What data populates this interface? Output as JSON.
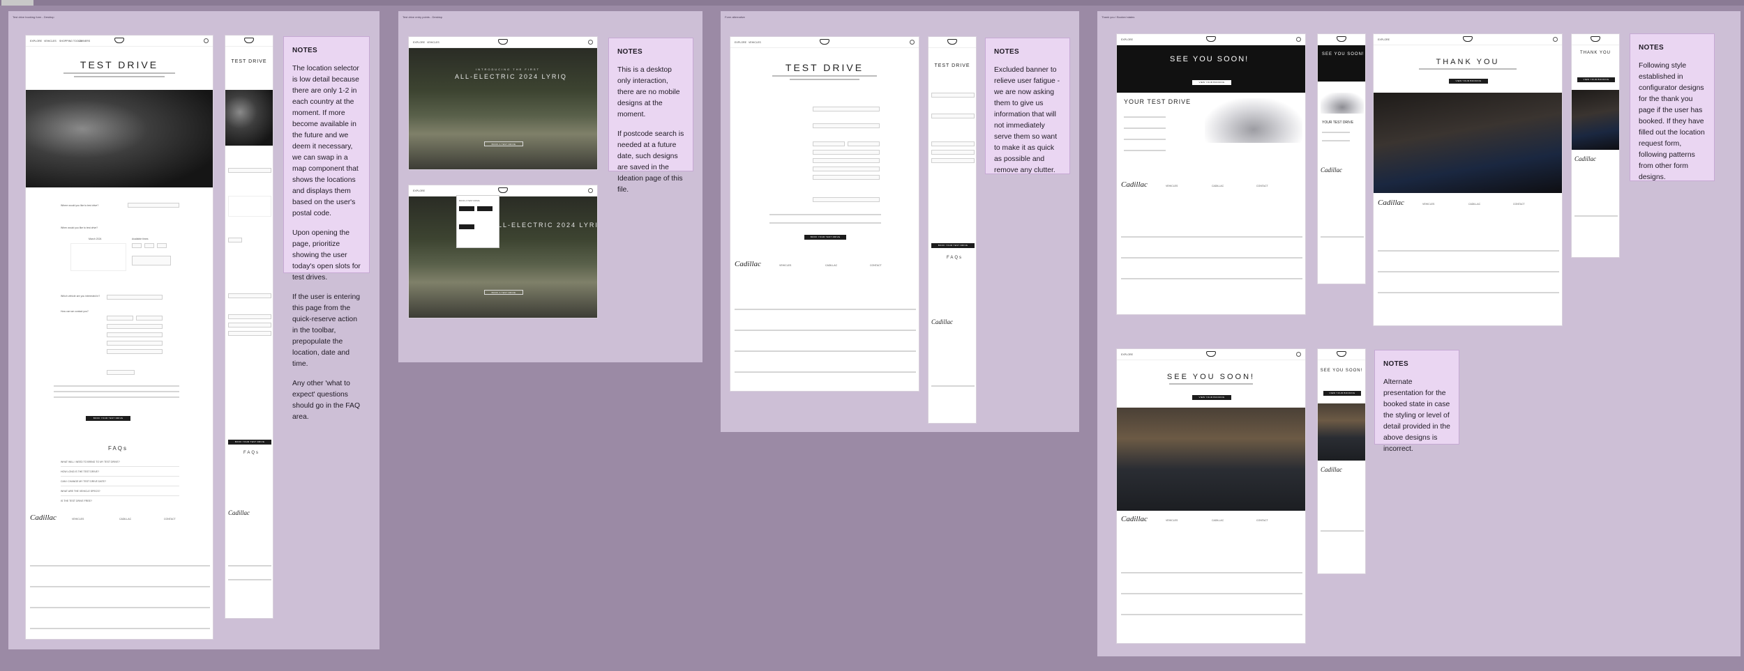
{
  "canvas": {
    "background": "#9b8aa5",
    "board_color": "#cdbfd6",
    "note_color": "#ead6f2"
  },
  "boards": [
    {
      "label": "Test drive booking form - Desktop"
    },
    {
      "label": "Test drive entry points - Desktop"
    },
    {
      "label": "Form alternative"
    },
    {
      "label": "Thank you / Booked states"
    }
  ],
  "brand": {
    "logo_text": "Cadillac"
  },
  "nav": {
    "links": [
      "EXPLORE",
      "VEHICLES",
      "SHOPPING TOOLS",
      "OWNERS"
    ]
  },
  "form_page": {
    "title": "TEST DRIVE",
    "location_question": "Where would you like to test drive?",
    "date_question": "When would you like to test drive?",
    "month": "March 2024",
    "time_label": "Available times",
    "interest_question": "Which vehicle are you interested in?",
    "contact_question": "How can we contact you?",
    "submit": "BOOK YOUR TEST DRIVE",
    "faq_title": "FAQs",
    "faqs": [
      "WHAT WILL I NEED TO BRING TO MY TEST DRIVE?",
      "HOW LONG IS THE TEST DRIVE?",
      "CAN I CHANGE MY TEST DRIVE DATE?",
      "WHAT ARE THE VEHICLE SPECS?",
      "IS THE TEST DRIVE FREE?"
    ],
    "footer_cols": [
      "VEHICLES",
      "CADILLAC",
      "CONTACT"
    ]
  },
  "entry_page": {
    "hero_kicker": "INTRODUCING THE FIRST",
    "hero_title": "ALL-ELECTRIC 2024 LYRIQ",
    "hero_cta": "BOOK A TEST DRIVE",
    "menu_title": "BOOK A TEST DRIVE"
  },
  "alt_form": {
    "title": "TEST DRIVE",
    "faq_title": "FAQs"
  },
  "thanks": {
    "see_you": "SEE YOU SOON!",
    "your_test_drive": "YOUR TEST DRIVE",
    "thank_you": "THANK YOU",
    "cta": "VIEW YOUR BOOKING"
  },
  "notes": [
    {
      "title": "NOTES",
      "paragraphs": [
        "The location selector is low detail because there are only 1-2 in each country at the moment. If more become available in the future and we deem it necessary, we can swap in a map component that shows the locations and displays them based on the user's postal code.",
        "Upon opening the page, prioritize showing the user today's open slots for test drives.",
        "If the user is entering this page from the quick-reserve action in the toolbar, prepopulate the location, date and time.",
        "Any other 'what to expect' questions should go in the FAQ area."
      ]
    },
    {
      "title": "NOTES",
      "paragraphs": [
        "This is a desktop only interaction, there are no mobile designs at the moment.",
        "If postcode search is needed at a future date, such designs are saved in the Ideation page of this file."
      ]
    },
    {
      "title": "NOTES",
      "paragraphs": [
        "Excluded banner to relieve user fatigue - we are now asking them to give us information that will not immediately serve them so want to make it as quick as possible and remove any clutter."
      ]
    },
    {
      "title": "NOTES",
      "paragraphs": [
        "Following style established in configurator designs for the thank you page if the user has booked. If they have filled out the location request form, following patterns from other form designs."
      ]
    },
    {
      "title": "NOTES",
      "paragraphs": [
        "Alternate presentation for the booked state in case the styling or level of detail provided in the above designs is incorrect."
      ]
    }
  ]
}
